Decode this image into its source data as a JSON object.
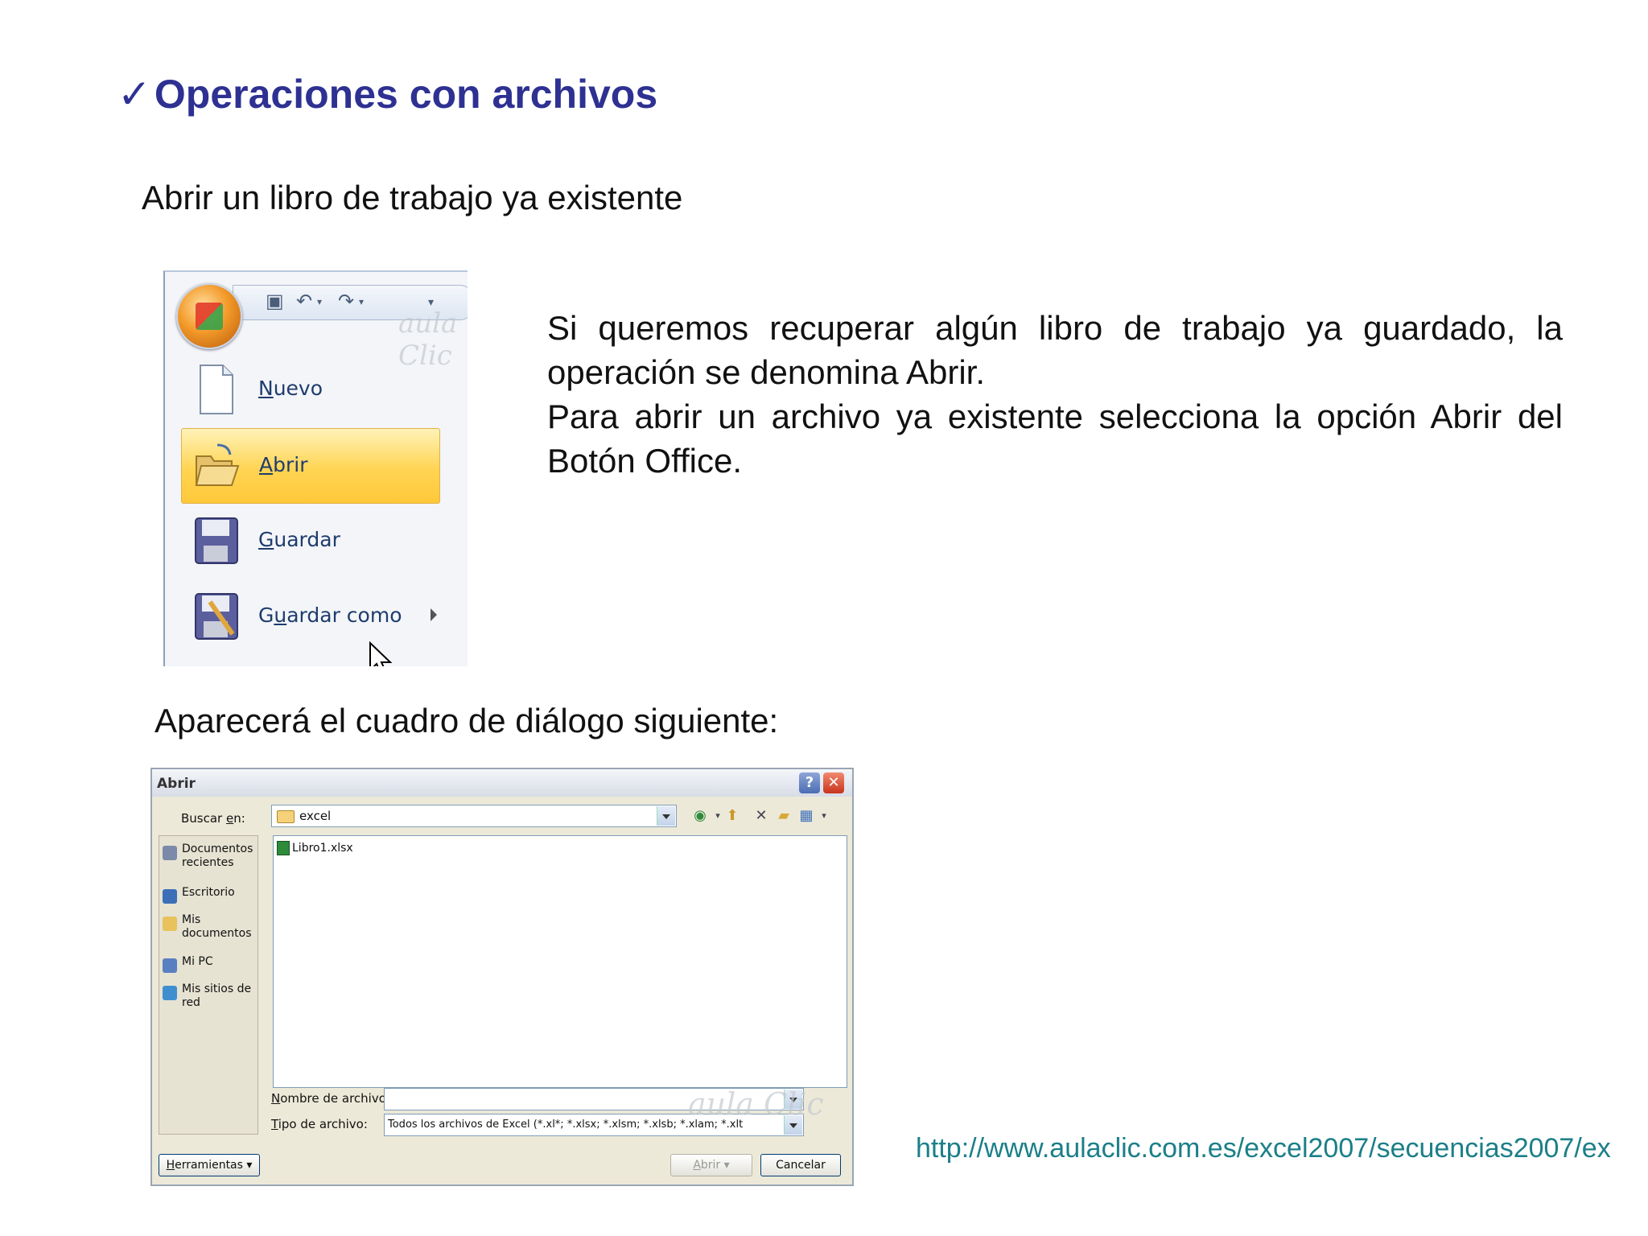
{
  "slide": {
    "title": "Operaciones con archivos",
    "check_mark": "✓",
    "subtitle_open": "Abrir un libro de trabajo ya existente",
    "paragraph_1": "Si queremos recuperar algún libro de trabajo ya guardado, la operación se denomina Abrir.",
    "paragraph_2": "Para abrir un archivo ya existente selecciona la opción Abrir del Botón Office.",
    "subtitle_dialog": "Aparecerá el cuadro de diálogo siguiente:",
    "url": "http://www.aulaclic.com.es/excel2007/secuencias2007/ex"
  },
  "office_menu": {
    "items": [
      {
        "label": "Nuevo",
        "icon": "new-document-icon"
      },
      {
        "label": "Abrir",
        "icon": "open-folder-icon",
        "active": true
      },
      {
        "label": "Guardar",
        "icon": "floppy-disk-icon"
      },
      {
        "label": "Guardar como",
        "icon": "save-as-icon",
        "has_submenu": true
      }
    ],
    "watermark": "aula Clic"
  },
  "dialog": {
    "title": "Abrir",
    "help_symbol": "?",
    "close_symbol": "✕",
    "look_in_label": "Buscar en:",
    "look_in_value": "excel",
    "places": [
      {
        "label": "Documentos recientes",
        "icon": "recent-documents-icon",
        "color": "#7a8aa8"
      },
      {
        "label": "Escritorio",
        "icon": "desktop-icon",
        "color": "#3d6fb8"
      },
      {
        "label": "Mis documentos",
        "icon": "my-documents-icon",
        "color": "#e8c25a"
      },
      {
        "label": "Mi PC",
        "icon": "my-computer-icon",
        "color": "#5a7fc0"
      },
      {
        "label": "Mis sitios de red",
        "icon": "network-places-icon",
        "color": "#3f8fd0"
      }
    ],
    "files": [
      {
        "name": "Libro1.xlsx",
        "icon": "excel-file-icon"
      }
    ],
    "file_name_label": "Nombre de archivo:",
    "file_name_value": "",
    "file_type_label": "Tipo de archivo:",
    "file_type_value": "Todos los archivos de Excel (*.xl*; *.xlsx; *.xlsm; *.xlsb; *.xlam; *.xlt",
    "tools_button": "Herramientas",
    "open_button": "Abrir",
    "cancel_button": "Cancelar",
    "watermark": "aula Clic"
  },
  "colors": {
    "title": "#2e3192",
    "url": "#1b7f88",
    "menu_highlight": "#ffd452"
  }
}
